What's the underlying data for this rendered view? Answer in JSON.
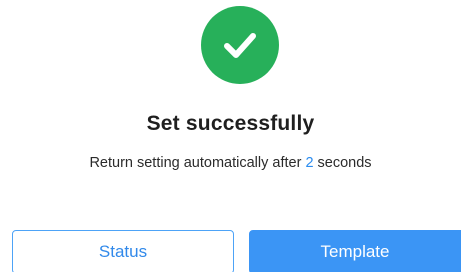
{
  "icon": "checkmark-circle-icon",
  "colors": {
    "success": "#27b05a",
    "accent": "#2a8cf0",
    "primary_button": "#3b95f5"
  },
  "message": {
    "title": "Set successfully",
    "subtitle_prefix": "Return setting automatically after",
    "countdown": "2",
    "subtitle_suffix": "seconds"
  },
  "buttons": {
    "status_label": "Status",
    "template_label": "Template"
  }
}
